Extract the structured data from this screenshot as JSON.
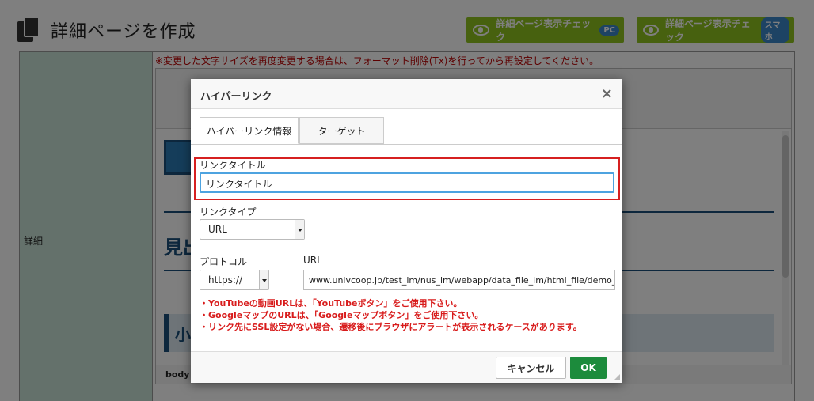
{
  "page": {
    "title": "詳細ページを作成",
    "check_pc_label": "詳細ページ表示チェック",
    "check_pc_tag": "PC",
    "check_sp_label": "詳細ページ表示チェック",
    "check_sp_tag": "スマホ",
    "row_label": "詳細",
    "notice": "※変更した文字サイズを再度変更する場合は、フォーマット削除(Tx)を行ってから再設定してください。",
    "editor_heading_fragment": "見出",
    "editor_subheading_fragment": "小",
    "editor_status": "body"
  },
  "dialog": {
    "title": "ハイパーリンク",
    "close_icon": "×",
    "tabs": [
      {
        "label": "ハイパーリンク情報",
        "active": true
      },
      {
        "label": "ターゲット",
        "active": false
      }
    ],
    "link_title_label": "リンクタイトル",
    "link_title_value": "リンクタイトル",
    "link_type_label": "リンクタイプ",
    "link_type_value": "URL",
    "protocol_label": "プロトコル",
    "protocol_value": "https://",
    "url_label": "URL",
    "url_value": "www.univcoop.jp/test_im/nus_im/webapp/data_file_im/html_file/demo_im",
    "warnings": [
      "・YouTubeの動画URLは、「YouTubeボタン」をご使用下さい。",
      "・GoogleマップのURLは、「Googleマップボタン」をご使用下さい。",
      "・リンク先にSSL設定がない場合、遷移後にブラウザにアラートが表示されるケースがあります。"
    ],
    "cancel_label": "キャンセル",
    "ok_label": "OK"
  },
  "colors": {
    "check_button": "#8ec31f",
    "ok_button": "#1c8b3c",
    "highlight_border": "#d62020",
    "warning_text": "#d81b1b",
    "label_cell": "#c9e3d6"
  }
}
